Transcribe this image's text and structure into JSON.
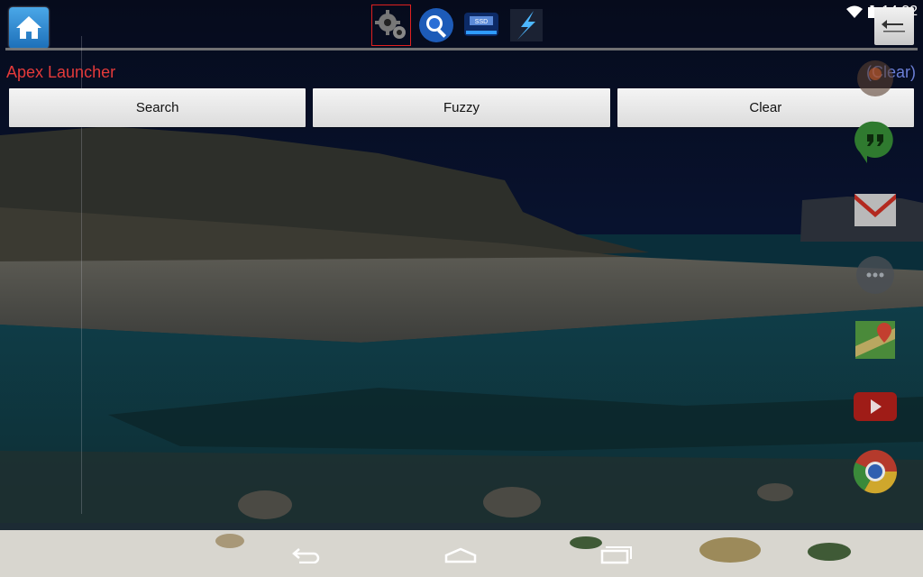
{
  "status_bar": {
    "time": "14:32"
  },
  "toolbar": {
    "buttons": [
      {
        "icon": "gears-icon",
        "active": true
      },
      {
        "icon": "search-magnifier-icon",
        "active": false
      },
      {
        "icon": "ssd-drive-icon",
        "active": false,
        "label": "SSD"
      },
      {
        "icon": "lightning-icon",
        "active": false
      }
    ]
  },
  "header": {
    "app_name": "Apex Launcher",
    "clear_link": "(Clear)"
  },
  "search_row": {
    "search_label": "Search",
    "fuzzy_label": "Fuzzy",
    "clear_label": "Clear"
  },
  "dock": {
    "apps": [
      "contacts-icon",
      "hangouts-icon",
      "gmail-icon",
      "app-drawer-icon",
      "maps-icon",
      "youtube-icon",
      "chrome-icon"
    ]
  },
  "colors": {
    "accent_red": "#e53a3a",
    "link_blue": "#6b7fd6"
  }
}
